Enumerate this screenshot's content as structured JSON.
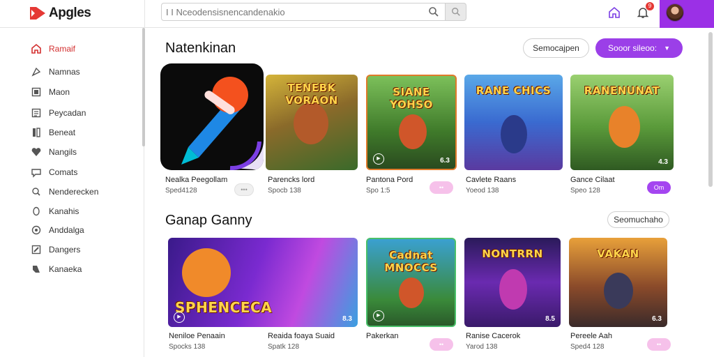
{
  "app": {
    "logo_text": "Apgles"
  },
  "search": {
    "placeholder": "I I Nceodensisnencandenakio"
  },
  "notifications": {
    "count": "9"
  },
  "sidebar": {
    "items": [
      {
        "label": "Ramaif",
        "icon": "home-icon",
        "active": true
      },
      {
        "label": "Namnas",
        "icon": "compass-icon"
      },
      {
        "label": "Maon",
        "icon": "square-icon"
      },
      {
        "label": "Peycadan",
        "icon": "list-icon"
      },
      {
        "label": "Beneat",
        "icon": "book-icon"
      },
      {
        "label": "Nangils",
        "icon": "heart-icon"
      },
      {
        "label": "Comats",
        "icon": "chat-icon"
      },
      {
        "label": "Nenderecken",
        "icon": "search-icon"
      },
      {
        "label": "Kanahis",
        "icon": "circle-icon"
      },
      {
        "label": "Anddalga",
        "icon": "settings-icon"
      },
      {
        "label": "Dangers",
        "icon": "edit-icon"
      },
      {
        "label": "Kanaeka",
        "icon": "tag-icon"
      }
    ]
  },
  "section1": {
    "title": "Natenkinan",
    "outline_button": "Semocajpen",
    "primary_button": "Sooor sileoo:",
    "cards": [
      {
        "name": "Nealka Peegollam",
        "meta": "Sped4128",
        "art": "",
        "rating": "",
        "tag": "",
        "tag_style": "grey"
      },
      {
        "name": "Parencks lord",
        "meta": "Spocb 138",
        "art": "TENEBK VORAON",
        "rating": "",
        "tag": "",
        "tag_style": "none"
      },
      {
        "name": "Pantona Pord",
        "meta": "Spo 1:5",
        "art": "SIANE YOHSO",
        "rating": "6.3",
        "tag": "",
        "tag_style": "pink"
      },
      {
        "name": "Cavlete Raans",
        "meta": "Yoeod 138",
        "art": "RANE CHICS",
        "rating": "",
        "tag": "",
        "tag_style": "none"
      },
      {
        "name": "Gance Cilaat",
        "meta": "Speo 128",
        "art": "RANENUNAT",
        "rating": "4.3",
        "tag": "Om",
        "tag_style": "purple"
      }
    ]
  },
  "section2": {
    "title": "Ganap Ganny",
    "outline_button": "Seomuchaho",
    "cards": [
      {
        "name": "Neniloe Penaain",
        "meta": "Spocks 138",
        "art": "SPHENCECA",
        "rating": "8.3",
        "tag": "",
        "tag_style": "none"
      },
      {
        "name": "Reaida foaya Suaid",
        "meta": "Spatk 128",
        "art": "",
        "rating": "",
        "tag": "",
        "tag_style": "none"
      },
      {
        "name": "Pakerkan",
        "meta": "",
        "art": "Cadnat MNOCCS",
        "rating": "",
        "tag": "",
        "tag_style": "pink"
      },
      {
        "name": "Ranise Cacerok",
        "meta": "Yarod 138",
        "art": "NONTRRN",
        "rating": "8.5",
        "tag": "",
        "tag_style": "none"
      },
      {
        "name": "Pereele Aah",
        "meta": "Sped4 128",
        "art": "VAKAN",
        "rating": "6.3",
        "tag": "",
        "tag_style": "pink"
      }
    ]
  },
  "colors": {
    "accent": "#9b3fe8",
    "active": "#d32f2f",
    "pink": "#f6c1ea"
  }
}
